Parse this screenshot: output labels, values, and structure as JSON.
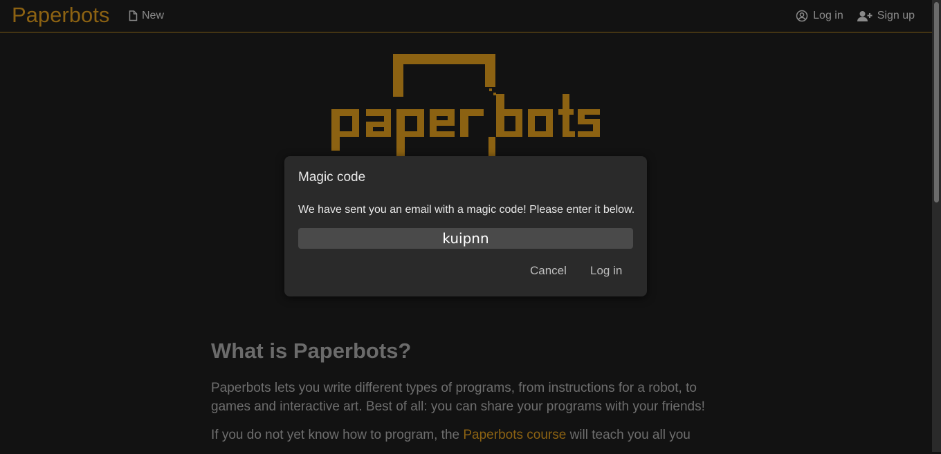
{
  "header": {
    "brand": "Paperbots",
    "new_label": "New",
    "login_label": "Log in",
    "signup_label": "Sign up",
    "icons": {
      "new": "file-icon",
      "login": "user-circle-icon",
      "signup": "user-plus-icon"
    }
  },
  "hero": {
    "logo_alt": "paperbots"
  },
  "content": {
    "heading": "What is Paperbots?",
    "para1": "Paperbots lets you write different types of programs, from instructions for a robot, to games and interactive art. Best of all: you can share your programs with your friends!",
    "para2_prefix": "If you do not yet know how to program, the ",
    "para2_link": "Paperbots course",
    "para2_suffix": " will teach you all you"
  },
  "modal": {
    "title": "Magic code",
    "message": "We have sent you an email with a magic code! Please enter it below.",
    "code_value": "kuipnn",
    "cancel_label": "Cancel",
    "login_label": "Log in"
  },
  "colors": {
    "accent": "#8c6212",
    "background": "#121212",
    "modal_bg": "#2a2a2a",
    "input_bg": "#4a4a4a"
  }
}
